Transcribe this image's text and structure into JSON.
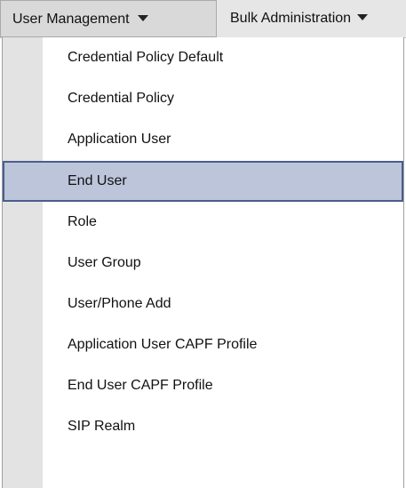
{
  "menubar": {
    "items": [
      {
        "label": "User Management",
        "icon": "caret-down-icon",
        "state": "open"
      },
      {
        "label": "Bulk Administration",
        "icon": "caret-down-icon",
        "state": "closed"
      }
    ]
  },
  "dropdown": {
    "items": [
      {
        "label": "Credential Policy Default"
      },
      {
        "label": "Credential Policy"
      },
      {
        "label": "Application User"
      },
      {
        "label": "End User",
        "selected": true
      },
      {
        "label": "Role"
      },
      {
        "label": "User Group"
      },
      {
        "label": "User/Phone Add"
      },
      {
        "label": "Application User CAPF Profile"
      },
      {
        "label": "End User CAPF Profile"
      },
      {
        "label": "SIP Realm"
      }
    ]
  },
  "colors": {
    "selected_bg": "#bcc5da",
    "selected_border": "#4a5d8e",
    "gutter": "#e3e3e3",
    "menubar": "#e6e6e6"
  }
}
